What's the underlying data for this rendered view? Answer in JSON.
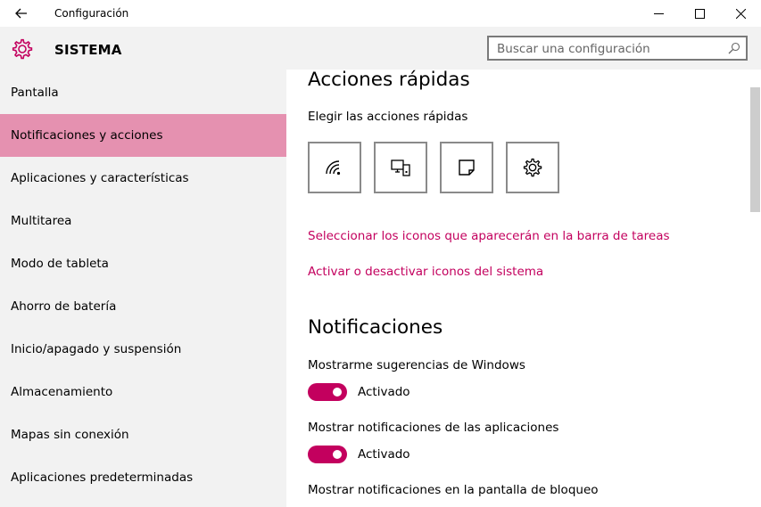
{
  "window": {
    "title": "Configuración"
  },
  "header": {
    "title": "SISTEMA",
    "search_placeholder": "Buscar una configuración"
  },
  "sidebar": {
    "items": [
      {
        "label": "Pantalla"
      },
      {
        "label": "Notificaciones y acciones"
      },
      {
        "label": "Aplicaciones y características"
      },
      {
        "label": "Multitarea"
      },
      {
        "label": "Modo de tableta"
      },
      {
        "label": "Ahorro de batería"
      },
      {
        "label": "Inicio/apagado y suspensión"
      },
      {
        "label": "Almacenamiento"
      },
      {
        "label": "Mapas sin conexión"
      },
      {
        "label": "Aplicaciones predeterminadas"
      }
    ],
    "active_index": 1
  },
  "quick_actions": {
    "heading": "Acciones rápidas",
    "subheading": "Elegir las acciones rápidas",
    "tiles": [
      {
        "icon": "wifi-icon"
      },
      {
        "icon": "project-screen-icon"
      },
      {
        "icon": "note-icon"
      },
      {
        "icon": "settings-gear-icon"
      }
    ],
    "link_taskbar_icons": "Seleccionar los iconos que aparecerán en la barra de tareas",
    "link_system_icons": "Activar o desactivar iconos del sistema"
  },
  "notifications": {
    "heading": "Notificaciones",
    "settings": [
      {
        "label": "Mostrarme sugerencias de Windows",
        "state": "Activado",
        "on": true
      },
      {
        "label": "Mostrar notificaciones de las aplicaciones",
        "state": "Activado",
        "on": true
      },
      {
        "label": "Mostrar notificaciones en la pantalla de bloqueo"
      }
    ]
  },
  "colors": {
    "accent": "#c3005e",
    "active_nav": "#e591b0",
    "sidebar_bg": "#f2f2f2"
  }
}
